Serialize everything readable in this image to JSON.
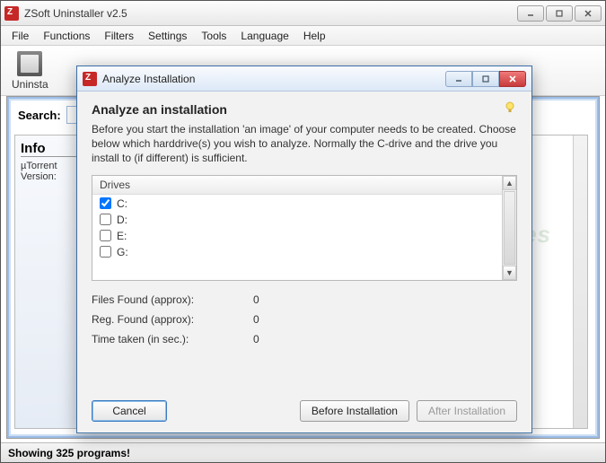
{
  "window": {
    "title": "ZSoft Uninstaller v2.5"
  },
  "menubar": [
    "File",
    "Functions",
    "Filters",
    "Settings",
    "Tools",
    "Language",
    "Help"
  ],
  "toolbar": {
    "uninstall_label": "Uninsta"
  },
  "main": {
    "search_label": "Search:",
    "info": {
      "header": "Info",
      "line1": "µTorrent",
      "line2": "Version:"
    }
  },
  "statusbar": "Showing 325 programs!",
  "dialog": {
    "title": "Analyze Installation",
    "heading": "Analyze an installation",
    "description": "Before you start the installation 'an image' of your computer needs to be created. Choose below which harddrive(s) you wish to analyze. Normally the C-drive and the drive you install to (if different) is sufficient.",
    "drives_header": "Drives",
    "drives": [
      {
        "label": "C:",
        "checked": true
      },
      {
        "label": "D:",
        "checked": false
      },
      {
        "label": "E:",
        "checked": false
      },
      {
        "label": "G:",
        "checked": false
      }
    ],
    "stats": {
      "files_label": "Files Found (approx):",
      "files_value": "0",
      "reg_label": "Reg. Found (approx):",
      "reg_value": "0",
      "time_label": "Time taken (in sec.):",
      "time_value": "0"
    },
    "buttons": {
      "cancel": "Cancel",
      "before": "Before Installation",
      "after": "After Installation"
    }
  },
  "watermark": "SnapFiles"
}
